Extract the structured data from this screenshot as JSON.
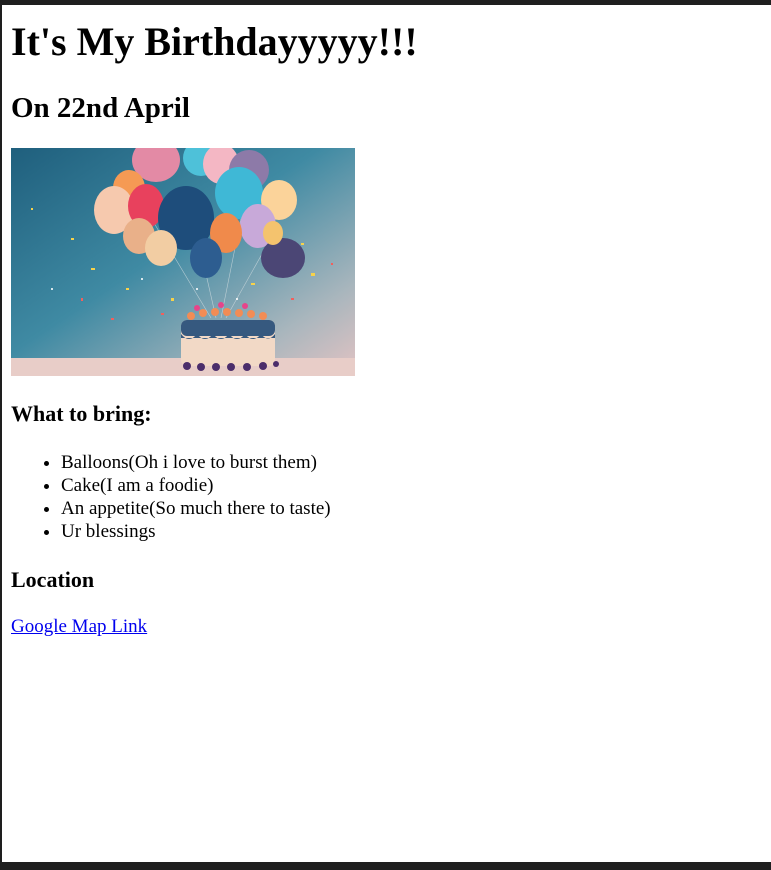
{
  "page": {
    "title": "It's My Birthdayyyyy!!!",
    "date_heading": "On 22nd April",
    "bring_heading": "What to bring:",
    "bring_items": [
      "Balloons(Oh i love to burst them)",
      "Cake(I am a foodie)",
      "An appetite(So much there to taste)",
      "Ur blessings"
    ],
    "location_heading": "Location",
    "map_link_text": "Google Map Link"
  },
  "image": {
    "description_name": "birthday-balloons-cake-image",
    "colors": {
      "background_top": "#2b6a86",
      "background_mid": "#4d93a8",
      "background_right": "#c9b3b6",
      "table": "#e7c9c4"
    }
  }
}
